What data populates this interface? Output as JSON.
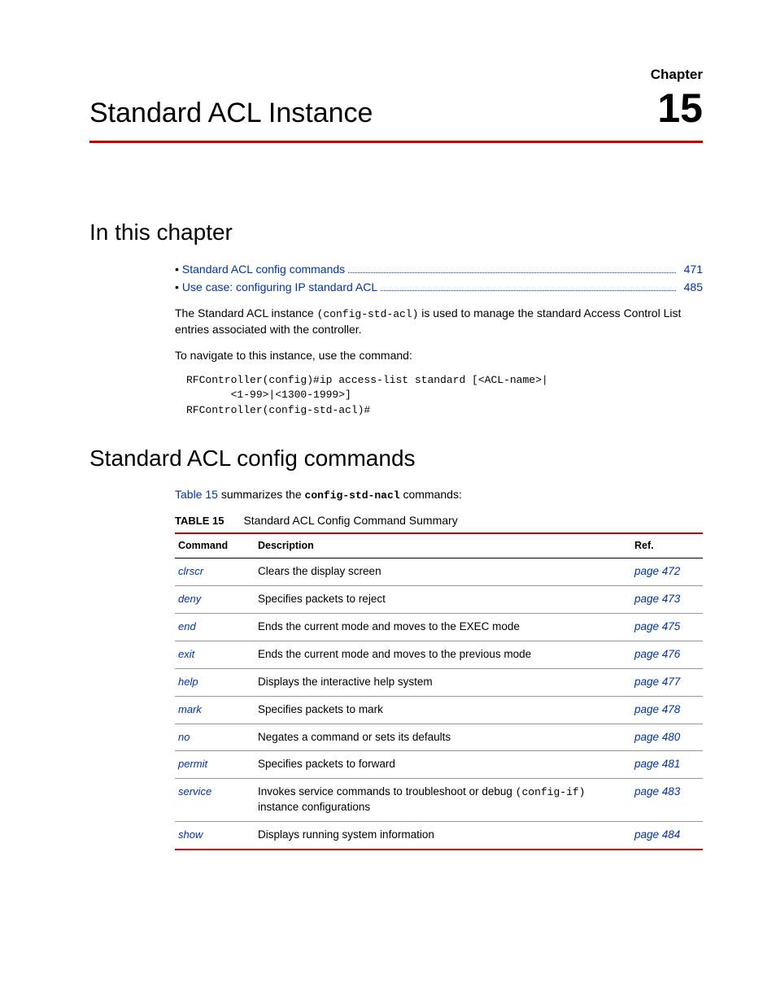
{
  "header": {
    "chapter_label": "Chapter",
    "chapter_number": "15",
    "title": "Standard ACL Instance"
  },
  "section1": {
    "heading": "In this chapter",
    "toc": [
      {
        "label": "Standard ACL config commands",
        "page": "471"
      },
      {
        "label": "Use case: configuring IP standard ACL",
        "page": "485"
      }
    ],
    "para1_a": "The Standard ACL instance ",
    "para1_code": "(config-std-acl)",
    "para1_b": " is used to manage the standard Access Control List entries associated with the controller.",
    "para2": "To navigate to this instance, use the command:",
    "code": "RFController(config)#ip access-list standard [<ACL-name>|\n       <1-99>|<1300-1999>]\nRFController(config-std-acl)#"
  },
  "section2": {
    "heading": "Standard ACL config commands",
    "intro_link": "Table 15",
    "intro_a": " summarizes the ",
    "intro_code": "config-std-nacl",
    "intro_b": " commands:",
    "table": {
      "caption_label": "TABLE 15",
      "caption_text": "Standard ACL Config Command Summary",
      "headers": {
        "command": "Command",
        "description": "Description",
        "ref": "Ref."
      },
      "rows": [
        {
          "command": "clrscr",
          "desc": "Clears the display screen",
          "ref": "page 472"
        },
        {
          "command": "deny",
          "desc": "Specifies packets to reject",
          "ref": "page 473"
        },
        {
          "command": "end",
          "desc": "Ends the current mode and moves to the EXEC mode",
          "ref": "page 475"
        },
        {
          "command": "exit",
          "desc": "Ends the current mode and moves to the previous mode",
          "ref": "page 476"
        },
        {
          "command": "help",
          "desc": "Displays the interactive help system",
          "ref": "page 477"
        },
        {
          "command": "mark",
          "desc": "Specifies packets to mark",
          "ref": "page 478"
        },
        {
          "command": "no",
          "desc": "Negates a command or sets its defaults",
          "ref": "page 480"
        },
        {
          "command": "permit",
          "desc": "Specifies packets to forward",
          "ref": "page 481"
        },
        {
          "command": "service",
          "desc": "Invokes service commands to troubleshoot or debug ",
          "desc_code": "(config-if)",
          "desc2": "  instance configurations",
          "ref": "page 483"
        },
        {
          "command": "show",
          "desc": "Displays running system information",
          "ref": "page 484"
        }
      ]
    }
  }
}
